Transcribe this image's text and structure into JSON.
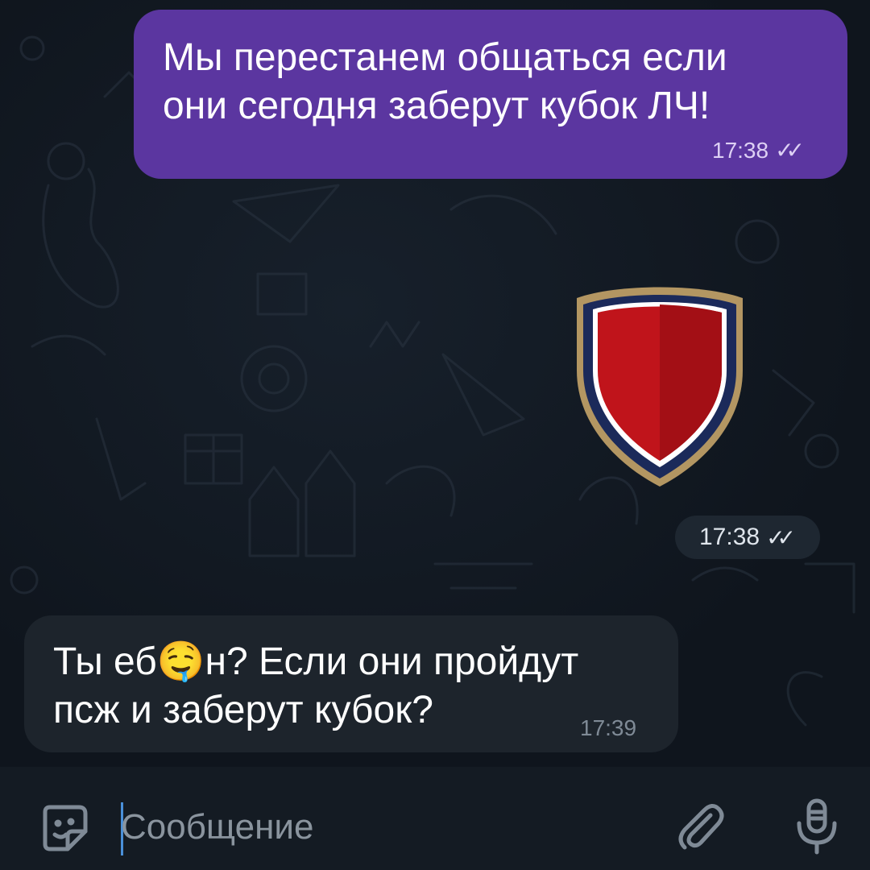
{
  "messages": [
    {
      "direction": "outgoing",
      "text": "Мы перестанем общаться если\nони сегодня заберут кубок ЛЧ!",
      "time": "17:38",
      "status": "read"
    },
    {
      "direction": "outgoing",
      "type": "sticker",
      "sticker": "red-shield-sticker",
      "time": "17:38",
      "status": "read"
    },
    {
      "direction": "incoming",
      "text": "Ты еб🤤н? Если они пройдут\nпсж и заберут кубок?",
      "time": "17:39"
    }
  ],
  "composer": {
    "placeholder": "Сообщение",
    "left_icon": "emoji-sticker-icon",
    "attach_icon": "paperclip-icon",
    "mic_icon": "microphone-icon"
  },
  "colors": {
    "chat_background": "#0f151d",
    "outgoing_bubble": "#5b36a0",
    "incoming_bubble": "#1d242c",
    "composer_bar": "#141b23",
    "caret": "#4a90d9",
    "shield_red": "#c0141b",
    "shield_navy": "#1b2a5a",
    "shield_gold": "#b39662"
  }
}
